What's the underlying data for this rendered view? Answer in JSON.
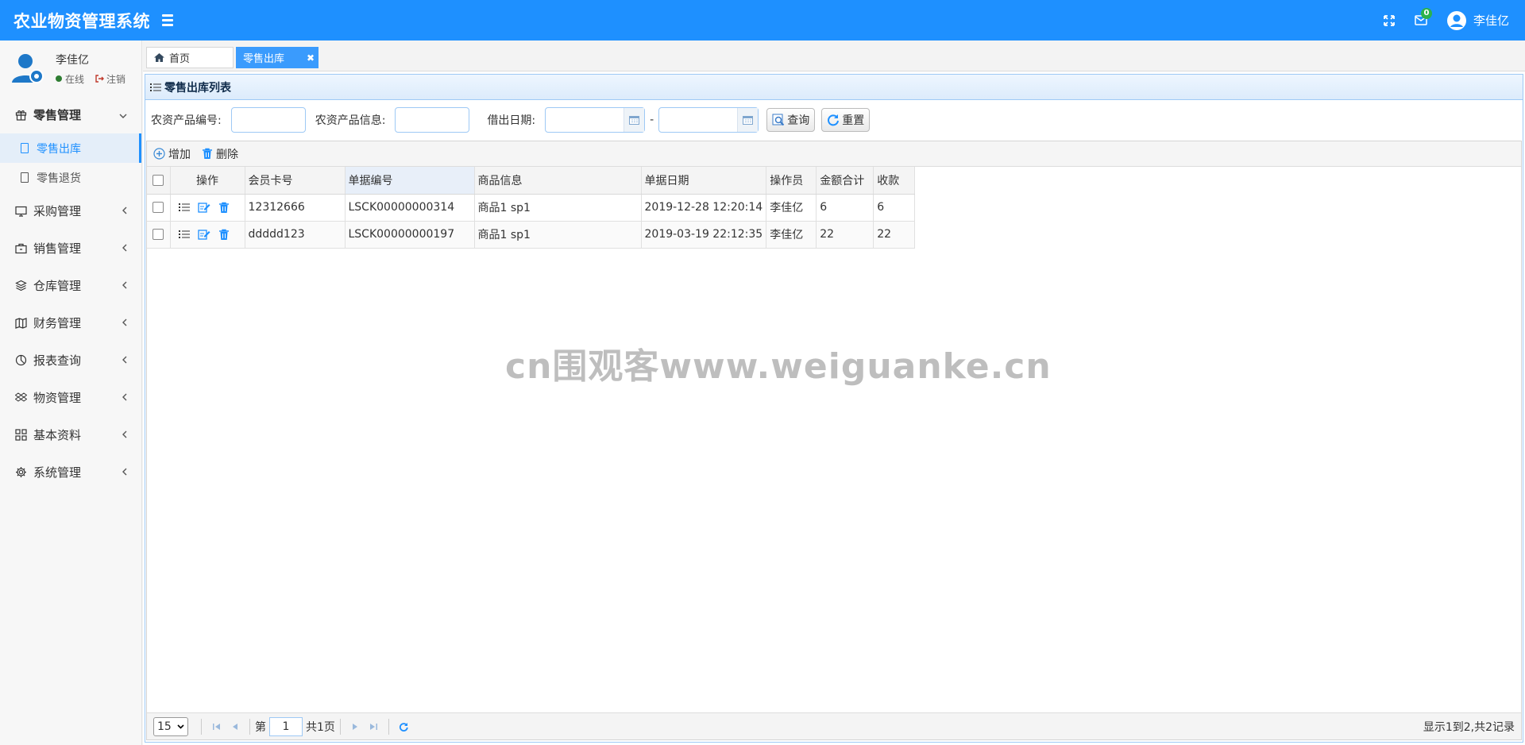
{
  "app": {
    "title": "农业物资管理系统",
    "accent": "#1e90ff"
  },
  "top": {
    "mail_count": "0",
    "user_name": "李佳亿"
  },
  "sidebar": {
    "user_name": "李佳亿",
    "status": "在线",
    "logout": "注销",
    "menus": [
      {
        "label": "零售管理",
        "icon": "gift-icon",
        "open": true,
        "children": [
          {
            "label": "零售出库",
            "active": true
          },
          {
            "label": "零售退货",
            "active": false
          }
        ]
      },
      {
        "label": "采购管理",
        "icon": "monitor-icon"
      },
      {
        "label": "销售管理",
        "icon": "briefcase-icon"
      },
      {
        "label": "仓库管理",
        "icon": "layers-icon"
      },
      {
        "label": "财务管理",
        "icon": "map-icon"
      },
      {
        "label": "报表查询",
        "icon": "pie-chart-icon"
      },
      {
        "label": "物资管理",
        "icon": "dropbox-icon"
      },
      {
        "label": "基本资料",
        "icon": "grid-icon"
      },
      {
        "label": "系统管理",
        "icon": "gear-icon"
      }
    ]
  },
  "tabs": [
    {
      "label": "首页"
    },
    {
      "label": "零售出库"
    }
  ],
  "panel": {
    "title": "零售出库列表"
  },
  "search": {
    "code_label": "农资产品编号:",
    "info_label": "农资产品信息:",
    "date_label": "借出日期:",
    "dash": "-",
    "query_btn": "查询",
    "reset_btn": "重置"
  },
  "toolbar": {
    "add": "增加",
    "delete": "删除"
  },
  "table": {
    "headers": [
      "操作",
      "会员卡号",
      "单据编号",
      "商品信息",
      "单据日期",
      "操作员",
      "金额合计",
      "收款"
    ],
    "rows": [
      {
        "card": "12312666",
        "doc": "LSCK00000000314",
        "goods": "商品1 sp1",
        "date": "2019-12-28 12:20:14",
        "operator": "李佳亿",
        "total": "6",
        "received": "6"
      },
      {
        "card": "ddddd123",
        "doc": "LSCK00000000197",
        "goods": "商品1 sp1",
        "date": "2019-03-19 22:12:35",
        "operator": "李佳亿",
        "total": "22",
        "received": "22"
      }
    ]
  },
  "pager": {
    "page_size": "15",
    "page_prefix": "第",
    "page_value": "1",
    "page_suffix": "共1页",
    "info": "显示1到2,共2记录"
  },
  "watermark": "cn围观客www.weiguanke.cn"
}
